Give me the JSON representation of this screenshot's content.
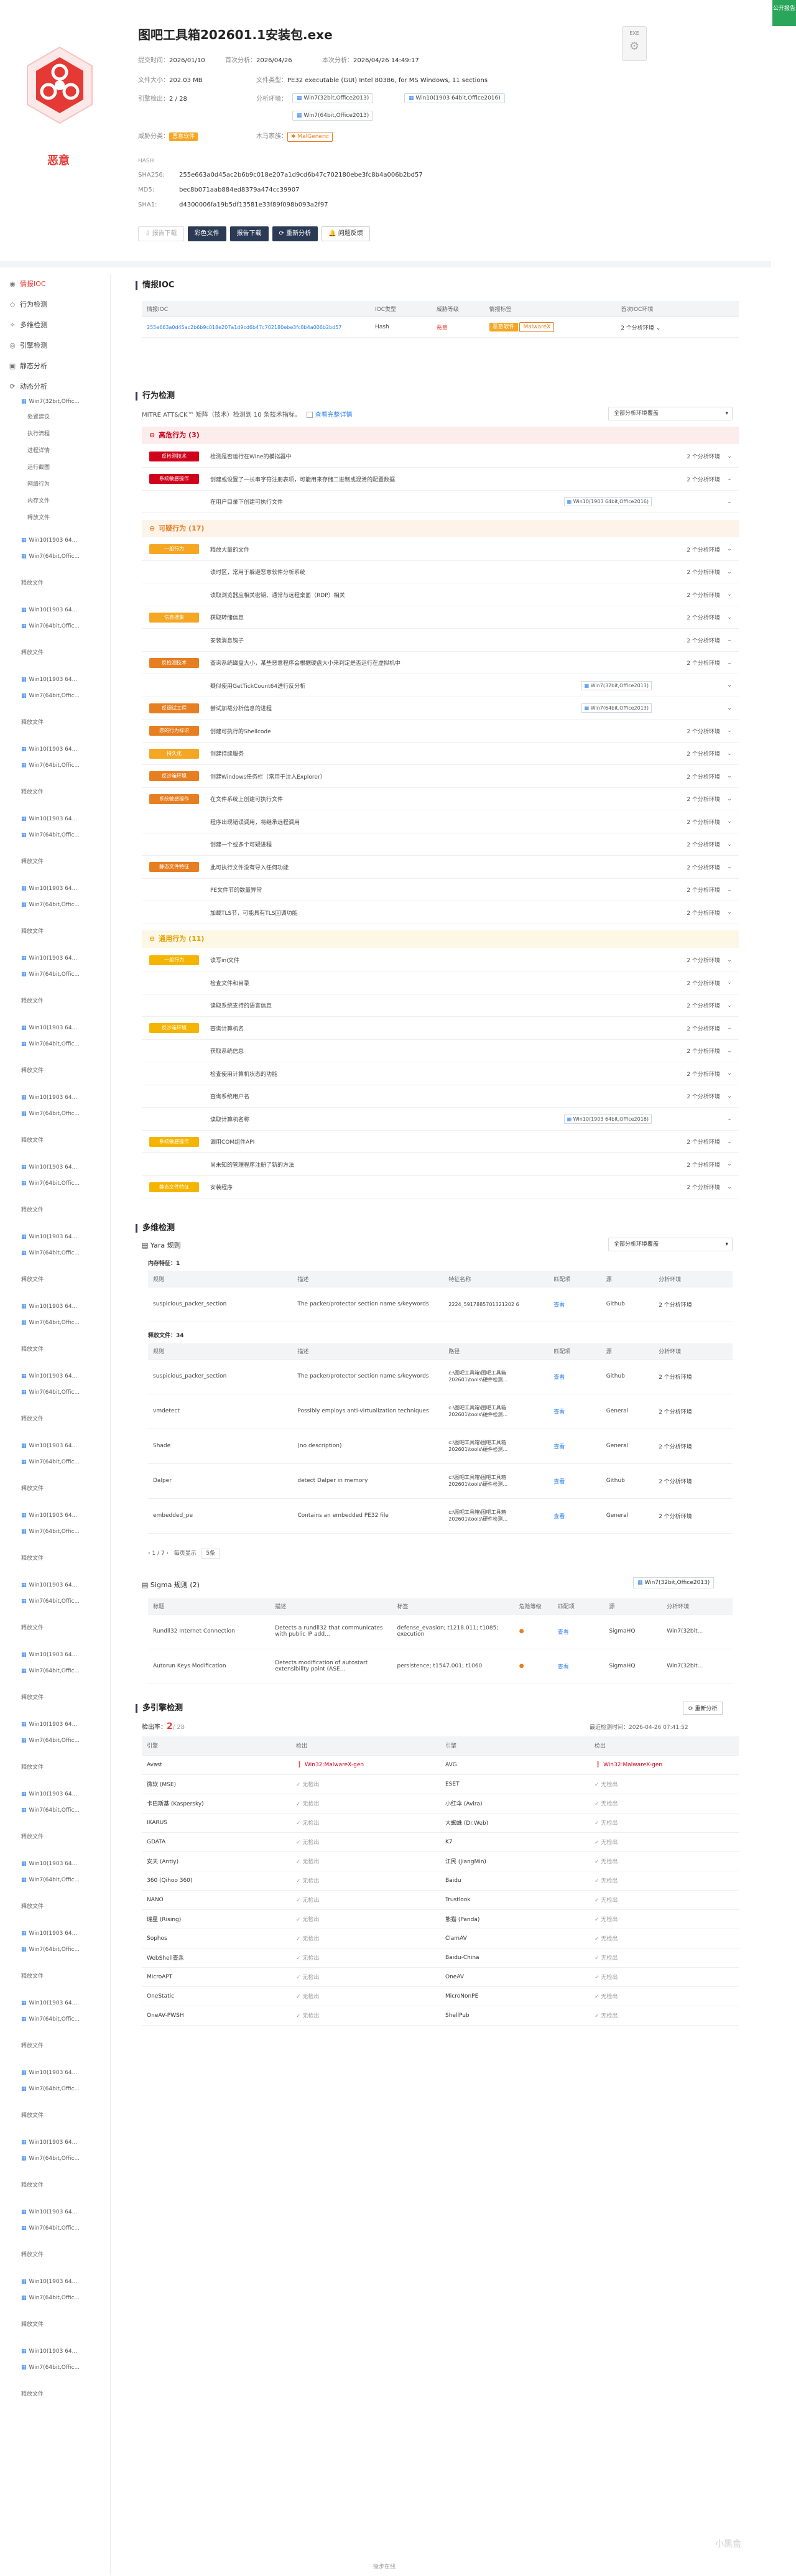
{
  "corner_badge": "公开报告",
  "file": {
    "name": "图吧工具箱202601.1安装包.exe",
    "verdict": "恶意",
    "icon_text": "EXE",
    "submit_label": "提交时间：",
    "submit_value": "2026/01/10",
    "first_label": "首次分析：",
    "first_value": "2026/04/26",
    "last_label": "本次分析：",
    "last_value": "2026/04/26 14:49:17",
    "size_label": "文件大小：",
    "size_value": "202.03 MB",
    "type_label": "文件类型：",
    "type_value": "PE32 executable (GUI) Intel 80386, for MS Windows, 11 sections",
    "engine_label": "引擎检出：",
    "engine_value": "2 / 28",
    "env_label": "分析环境：",
    "envs": [
      "Win7(32bit,Office2013)",
      "Win10(1903 64bit,Office2016)",
      "Win7(64bit,Office2013)"
    ],
    "threat_label": "威胁分类：",
    "threat_tag": "恶意软件",
    "family_label": "木马家族：",
    "family_tag": "MalGeneric",
    "hash_title": "HASH",
    "sha256_label": "SHA256:",
    "sha256": "255e663a0d45ac2b6b9c018e207a1d9cd6b47c702180ebe3fc8b4a006b2bd57",
    "md5_label": "MD5:",
    "md5": "bec8b071aab884ed8379a474cc39907",
    "sha1_label": "SHA1:",
    "sha1": "d4300006fa19b5df13581e33f89f098b093a2f97"
  },
  "actions": [
    "报告下载",
    "彩色文件",
    "报告下载",
    "重新分析",
    "问题反馈"
  ],
  "sidebar": {
    "items": [
      {
        "icon": "◉",
        "label": "情报IOC"
      },
      {
        "icon": "◇",
        "label": "行为检测"
      },
      {
        "icon": "✧",
        "label": "多维检测"
      },
      {
        "icon": "◎",
        "label": "引擎检测"
      },
      {
        "icon": "▣",
        "label": "静态分析"
      },
      {
        "icon": "⟳",
        "label": "动态分析"
      }
    ],
    "dyn_env": "Win7(32bit,Offic...",
    "subs": [
      "处置建议",
      "执行流程",
      "进程详情",
      "运行截图",
      "网络行为",
      "内存文件",
      "释放文件"
    ],
    "repeat": [
      "Win10(1903 64...",
      "Win7(64bit,Offic...",
      "释放文件",
      "Win10(1903 64...",
      "Win7(64bit,Offic...",
      "释放文件",
      "Win10(1903 64...",
      "Win7(64bit,Offic...",
      "释放文件",
      "Win10(1903 64...",
      "Win7(64bit,Offic...",
      "释放文件",
      "Win10(1903 64...",
      "Win7(64bit,Offic...",
      "释放文件",
      "Win10(1903 64...",
      "Win7(64bit,Offic...",
      "释放文件",
      "Win10(1903 64...",
      "Win7(64bit,Offic...",
      "释放文件"
    ]
  },
  "ioc": {
    "title": "情报IOC",
    "headers": [
      "情报IOC",
      "IOC类型",
      "威胁等级",
      "情报标签",
      "首次IOC环境"
    ],
    "row": {
      "ioc": "255e663a0d45ac2b6b9c018e207a1d9cd6b47c702180ebe3fc8b4a006b2bd57",
      "type": "Hash",
      "level": "恶意",
      "tag1": "恶意软件",
      "tag2": "MalwareX",
      "env": "2 个分析环境"
    }
  },
  "behavior": {
    "title": "行为检测",
    "desc": "MITRE ATT&CK™ 矩阵（技术）检测到 10 条技术指标。",
    "check": "查看完整详情",
    "select": "全部分析环境覆盖",
    "groups": [
      {
        "name": "高危行为 (3)",
        "color": "#d0021b",
        "bg": "#fdecec",
        "rows": [
          {
            "cat": "反检测技术",
            "cc": "#d0021b",
            "txt": "检测是否运行在Wine的模拟器中",
            "env": "",
            "cnt": "2 个分析环境"
          },
          {
            "cat": "系统敏感操作",
            "cc": "#d0021b",
            "txt": "创建或设置了一长串字符注册表项，可能用来存储二进制或混淆的配置数据",
            "env": "",
            "cnt": "2 个分析环境"
          },
          {
            "cat": "",
            "cc": "",
            "txt": "在用户目录下创建可执行文件",
            "env": "Win10(1903 64bit,Office2016)",
            "cnt": ""
          }
        ]
      },
      {
        "name": "可疑行为 (17)",
        "color": "#e67e22",
        "bg": "#fdf3e8",
        "rows": [
          {
            "cat": "一般行为",
            "cc": "#f5a623",
            "txt": "释放大量的文件",
            "env": "",
            "cnt": "2 个分析环境"
          },
          {
            "cat": "",
            "cc": "",
            "txt": "读时区，常用于躲避恶意软件分析系统",
            "env": "",
            "cnt": "2 个分析环境"
          },
          {
            "cat": "",
            "cc": "",
            "txt": "读取浏览器应相关密钥、通常与远程桌面（RDP）相关",
            "env": "",
            "cnt": "2 个分析环境"
          },
          {
            "cat": "信息搜集",
            "cc": "#f5a623",
            "txt": "获取转储信息",
            "env": "",
            "cnt": "2 个分析环境"
          },
          {
            "cat": "",
            "cc": "",
            "txt": "安装消息钩子",
            "env": "",
            "cnt": "2 个分析环境"
          },
          {
            "cat": "反检测技术",
            "cc": "#e67e22",
            "txt": "查询系统磁盘大小，某些恶意程序会根据硬盘大小来判定是否运行在虚拟机中",
            "env": "",
            "cnt": "2 个分析环境"
          },
          {
            "cat": "",
            "cc": "",
            "txt": "疑似使用GetTickCount64进行反分析",
            "env": "Win7(32bit,Office2013)",
            "cnt": ""
          },
          {
            "cat": "反调试工程",
            "cc": "#e67e22",
            "txt": "尝试加载分析信息的进程",
            "env": "Win7(64bit,Office2013)",
            "cnt": ""
          },
          {
            "cat": "您的行为标识",
            "cc": "#e67e22",
            "txt": "创建可执行的Shellcode",
            "env": "",
            "cnt": "2 个分析环境"
          },
          {
            "cat": "持久化",
            "cc": "#f5a623",
            "txt": "创建持续服务",
            "env": "",
            "cnt": "2 个分析环境"
          },
          {
            "cat": "反沙箱环境",
            "cc": "#e67e22",
            "txt": "创建Windows任务栏（常用于注入Explorer）",
            "env": "",
            "cnt": "2 个分析环境"
          },
          {
            "cat": "系统敏感操作",
            "cc": "#e67e22",
            "txt": "在文件系统上创建可执行文件",
            "env": "",
            "cnt": "2 个分析环境"
          },
          {
            "cat": "",
            "cc": "",
            "txt": "程序出现错误调用，将继承远程调用",
            "env": "",
            "cnt": "2 个分析环境"
          },
          {
            "cat": "",
            "cc": "",
            "txt": "创建一个或多个可疑进程",
            "env": "",
            "cnt": "2 个分析环境"
          },
          {
            "cat": "静态文件特征",
            "cc": "#e67e22",
            "txt": "此可执行文件没有导入任何功能",
            "env": "",
            "cnt": "2 个分析环境"
          },
          {
            "cat": "",
            "cc": "",
            "txt": "PE文件节的数量异常",
            "env": "",
            "cnt": "2 个分析环境"
          },
          {
            "cat": "",
            "cc": "",
            "txt": "加载TLS节，可能具有TLS回调功能",
            "env": "",
            "cnt": "2 个分析环境"
          }
        ]
      },
      {
        "name": "通用行为 (11)",
        "color": "#e6a100",
        "bg": "#fdf7e6",
        "rows": [
          {
            "cat": "一般行为",
            "cc": "#f5b400",
            "txt": "读写ini文件",
            "env": "",
            "cnt": "2 个分析环境"
          },
          {
            "cat": "",
            "cc": "",
            "txt": "检查文件和目录",
            "env": "",
            "cnt": "2 个分析环境"
          },
          {
            "cat": "",
            "cc": "",
            "txt": "读取系统支持的语言信息",
            "env": "",
            "cnt": "2 个分析环境"
          },
          {
            "cat": "反沙箱环境",
            "cc": "#f5b400",
            "txt": "查询计算机名",
            "env": "",
            "cnt": "2 个分析环境"
          },
          {
            "cat": "",
            "cc": "",
            "txt": "获取系统信息",
            "env": "",
            "cnt": "2 个分析环境"
          },
          {
            "cat": "",
            "cc": "",
            "txt": "检查使用计算机状态的功能",
            "env": "",
            "cnt": "2 个分析环境"
          },
          {
            "cat": "",
            "cc": "",
            "txt": "查询系统用户名",
            "env": "",
            "cnt": "2 个分析环境"
          },
          {
            "cat": "",
            "cc": "",
            "txt": "读取计算机名称",
            "env": "Win10(1903 64bit,Office2016)",
            "cnt": ""
          },
          {
            "cat": "系统敏感操作",
            "cc": "#f5b400",
            "txt": "调用COM组件API",
            "env": "",
            "cnt": "2 个分析环境"
          },
          {
            "cat": "",
            "cc": "",
            "txt": "尚未知的管理程序注册了新的方法",
            "env": "",
            "cnt": "2 个分析环境"
          },
          {
            "cat": "静态文件特征",
            "cc": "#f5b400",
            "txt": "安装程序",
            "env": "",
            "cnt": "2 个分析环境"
          }
        ]
      }
    ]
  },
  "multi": {
    "title": "多维检测",
    "yara_title": "Yara 规则",
    "select": "全部分析环境覆盖",
    "mem_label": "内存特征：1",
    "mem_headers": [
      "规则",
      "描述",
      "特征名称",
      "匹配项",
      "源",
      "分析环境"
    ],
    "mem_rows": [
      [
        "suspicious_packer_section",
        "The packer/protector section name s/keywords",
        "2224_5917885701321202 6",
        "查看",
        "Github",
        "2 个分析环境"
      ]
    ],
    "file_label": "释放文件：34",
    "file_headers": [
      "规则",
      "描述",
      "路径",
      "匹配项",
      "源",
      "分析环境"
    ],
    "file_rows": [
      [
        "suspicious_packer_section",
        "The packer/protector section name s/keywords",
        "c:\\图吧工具箱\\图吧工具箱202601\\tools\\硬件检测...",
        "查看",
        "Github",
        "2 个分析环境"
      ],
      [
        "vmdetect",
        "Possibly employs anti-virtualization techniques",
        "c:\\图吧工具箱\\图吧工具箱202601\\tools\\硬件检测...",
        "查看",
        "General",
        "2 个分析环境"
      ],
      [
        "Shade",
        "(no description)",
        "c:\\图吧工具箱\\图吧工具箱202601\\tools\\硬件检测...",
        "查看",
        "General",
        "2 个分析环境"
      ],
      [
        "Dalper",
        "detect Dalper in memory",
        "c:\\图吧工具箱\\图吧工具箱202601\\tools\\硬件检测...",
        "查看",
        "Github",
        "2 个分析环境"
      ],
      [
        "embedded_pe",
        "Contains an embedded PE32 file",
        "c:\\图吧工具箱\\图吧工具箱202601\\tools\\硬件检测...",
        "查看",
        "General",
        "2 个分析环境"
      ]
    ],
    "pager": "1 / 7",
    "pager_jump": "每页显示",
    "pager_size": "5条",
    "sigma_title": "Sigma 规则 (2)",
    "sigma_env": "Win7(32bit,Office2013)",
    "sigma_headers": [
      "标题",
      "描述",
      "标签",
      "危险等级",
      "匹配项",
      "源",
      "分析环境"
    ],
    "sigma_rows": [
      [
        "Rundll32 Internet Connection",
        "Detects a rundll32 that communicates with public IP add...",
        "defense_evasion; t1218.011; t1085; execution",
        "●",
        "查看",
        "SigmaHQ",
        "Win7(32bit..."
      ],
      [
        "Autorun Keys Modification",
        "Detects modification of autostart extensibility point (ASE...",
        "persistence; t1547.001; t1060",
        "●",
        "查看",
        "SigmaHQ",
        "Win7(32bit..."
      ]
    ]
  },
  "engine": {
    "title": "多引擎检测",
    "count_label": "检出率：",
    "count": "2",
    "total": "/ 28",
    "refresh": "重新分析",
    "latest": "最近检测时间：2026-04-26 07:41:52",
    "headers": [
      "引擎",
      "检出",
      "引擎",
      "检出"
    ],
    "rows": [
      [
        "Avast",
        "Win32:MalwareX-gen",
        "AVG",
        "Win32:MalwareX-gen"
      ],
      [
        "微软 (MSE)",
        "无检出",
        "ESET",
        "无检出"
      ],
      [
        "卡巴斯基 (Kaspersky)",
        "无检出",
        "小红伞 (Avira)",
        "无检出"
      ],
      [
        "IKARUS",
        "无检出",
        "大蜘蛛 (Dr.Web)",
        "无检出"
      ],
      [
        "GDATA",
        "无检出",
        "K7",
        "无检出"
      ],
      [
        "安天 (Antiy)",
        "无检出",
        "江民 (JiangMin)",
        "无检出"
      ],
      [
        "360 (Qihoo 360)",
        "无检出",
        "Baidu",
        "无检出"
      ],
      [
        "NANO",
        "无检出",
        "Trustlook",
        "无检出"
      ],
      [
        "瑞星 (Rising)",
        "无检出",
        "熊猫 (Panda)",
        "无检出"
      ],
      [
        "Sophos",
        "无检出",
        "ClamAV",
        "无检出"
      ],
      [
        "WebShell查杀",
        "无检出",
        "Baidu-China",
        "无检出"
      ],
      [
        "MicroAPT",
        "无检出",
        "OneAV",
        "无检出"
      ],
      [
        "OneStatic",
        "无检出",
        "MicroNonPE",
        "无检出"
      ],
      [
        "OneAV-PWSH",
        "无检出",
        "ShellPub",
        "无检出"
      ]
    ]
  },
  "footer": "微步在线",
  "watermark": "小黑盒"
}
